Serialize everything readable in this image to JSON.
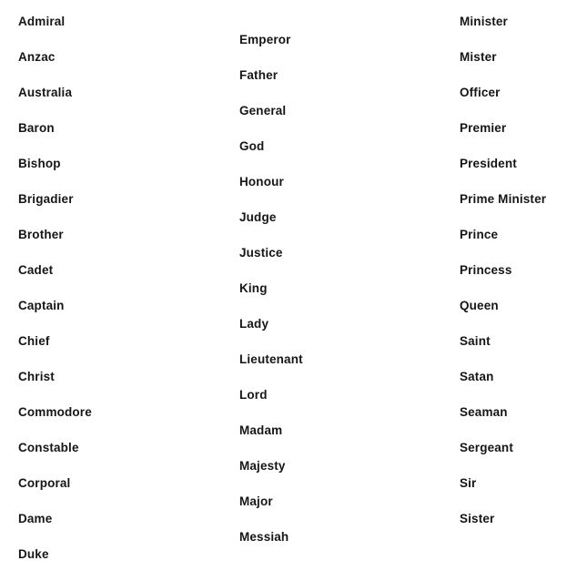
{
  "page": {
    "background_color": "#ffffff",
    "text_color": "#161616"
  },
  "columns": [
    {
      "id": "column-1",
      "items": [
        "Admiral",
        "Anzac",
        "Australia",
        "Baron",
        "Bishop",
        "Brigadier",
        "Brother",
        "Cadet",
        "Captain",
        "Chief",
        "Christ",
        "Commodore",
        "Constable",
        "Corporal",
        "Dame",
        "Duke"
      ]
    },
    {
      "id": "column-2",
      "items": [
        "Emperor",
        "Father",
        "General",
        "God",
        "Honour",
        "Judge",
        "Justice",
        "King",
        "Lady",
        "Lieutenant",
        "Lord",
        "Madam",
        "Majesty",
        "Major",
        "Messiah"
      ]
    },
    {
      "id": "column-3",
      "items": [
        "Minister",
        "Mister",
        "Officer",
        "Premier",
        "President",
        "Prime Minister",
        "Prince",
        "Princess",
        "Queen",
        "Saint",
        "Satan",
        "Seaman",
        "Sergeant",
        "Sir",
        "Sister"
      ]
    }
  ]
}
